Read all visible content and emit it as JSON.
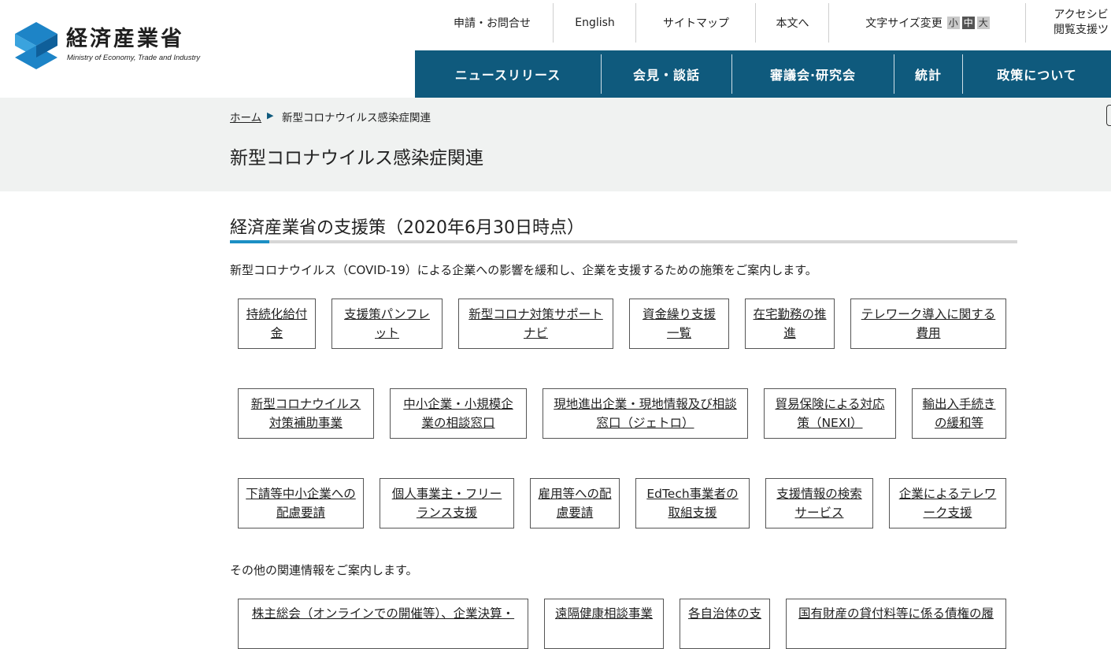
{
  "header": {
    "logo_jp": "経済産業省",
    "logo_en": "Ministry of Economy, Trade and Industry",
    "util_links": {
      "contact": "申請・お問合せ",
      "english": "English",
      "sitemap": "サイトマップ",
      "skip": "本文へ",
      "font_size_label": "文字サイズ変更",
      "font_small": "小",
      "font_medium": "中",
      "font_large": "大",
      "accessibility_line1": "アクセシビ",
      "accessibility_line2": "閲覧支援ツ"
    },
    "global_nav": [
      "ニュースリリース",
      "会見・談話",
      "審議会·研究会",
      "統計",
      "政策について"
    ]
  },
  "breadcrumb": {
    "home": "ホーム",
    "current": "新型コロナウイルス感染症関連"
  },
  "page_title": "新型コロナウイルス感染症関連",
  "section": {
    "title": "経済産業省の支援策（2020年6月30日時点）",
    "intro": "新型コロナウイルス（COVID-19）による企業への影響を緩和し、企業を支援するための施策をご案内します。",
    "support_buttons": [
      {
        "line1": "持続化給付",
        "line2": "金"
      },
      {
        "line1": "支援策パンフレ",
        "line2": "ット"
      },
      {
        "line1": "新型コロナ対策サポート",
        "line2": "ナビ"
      },
      {
        "line1": "資金繰り支援",
        "line2": "一覧"
      },
      {
        "line1": "在宅勤務の推",
        "line2": "進"
      },
      {
        "line1": "テレワーク導入に関する",
        "line2": "費用"
      },
      {
        "line1": "新型コロナウイルス",
        "line2": "対策補助事業"
      },
      {
        "line1": "中小企業・小規模企",
        "line2": "業の相談窓口"
      },
      {
        "line1": "現地進出企業・現地情報及び相談",
        "line2": "窓口（ジェトロ）"
      },
      {
        "line1": "貿易保険による対応",
        "line2": "策（NEXI）"
      },
      {
        "line1": "輸出入手続き",
        "line2": "の緩和等"
      },
      {
        "line1": "下請等中小企業への",
        "line2": "配慮要請"
      },
      {
        "line1": "個人事業主・フリー",
        "line2": "ランス支援"
      },
      {
        "line1": "雇用等への配",
        "line2": "慮要請"
      },
      {
        "line1": "EdTech事業者の",
        "line2": "取組支援"
      },
      {
        "line1": "支援情報の検索",
        "line2": "サービス"
      },
      {
        "line1": "企業によるテレワ",
        "line2": "ーク支援"
      }
    ],
    "other_intro": "その他の関連情報をご案内します。",
    "other_buttons": [
      {
        "line1": "株主総会（オンラインでの開催等）、企業決算・"
      },
      {
        "line1": "遠隔健康相談事業"
      },
      {
        "line1": "各自治体の支"
      },
      {
        "line1": "国有財産の貸付料等に係る債権の履"
      }
    ]
  },
  "colors": {
    "nav_bg": "#0f5a7d",
    "accent": "#1c8fc4",
    "band_bg": "#f0f2f1"
  }
}
